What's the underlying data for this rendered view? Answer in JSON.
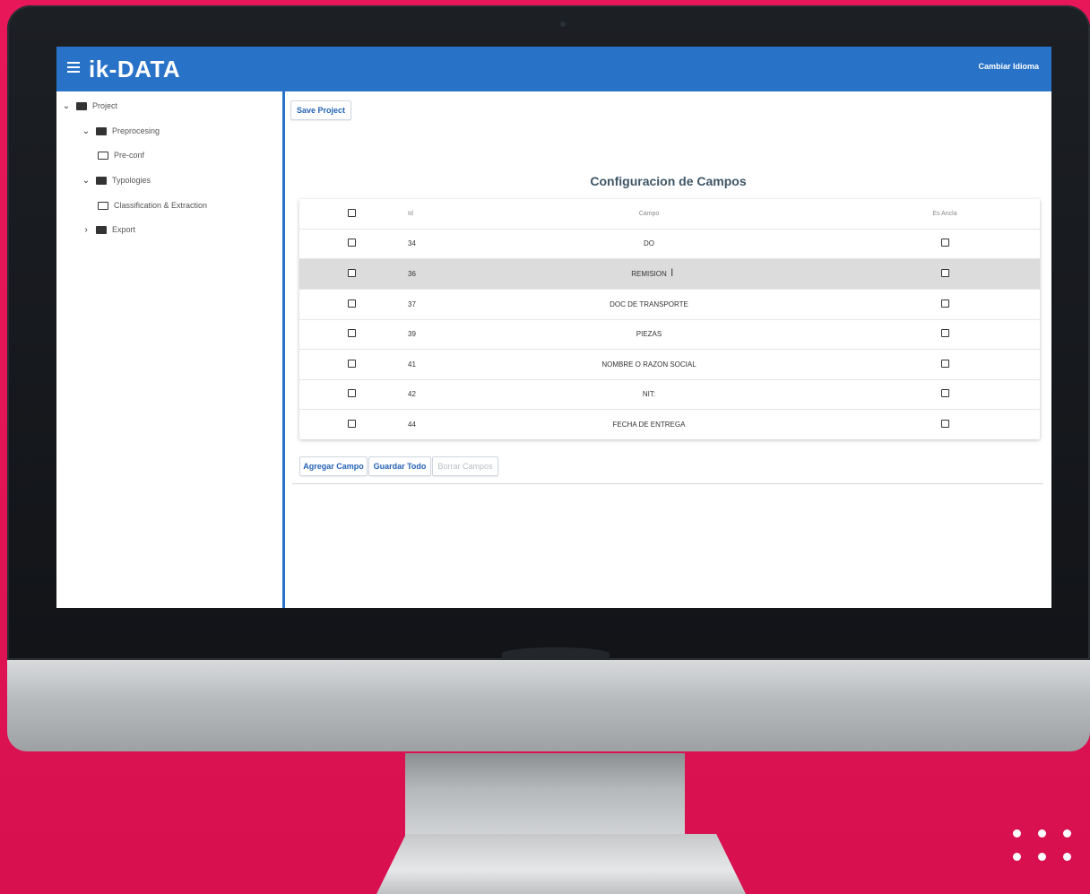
{
  "app": {
    "logo": "ik-DATA",
    "language_button": "Cambiar Idioma"
  },
  "sidebar": {
    "items": [
      {
        "label": "Project",
        "level": 0,
        "chevron": "down",
        "icon": "folder-filled-icon"
      },
      {
        "label": "Preprocesing",
        "level": 1,
        "chevron": "down",
        "icon": "folder-filled-icon"
      },
      {
        "label": "Pre-conf",
        "level": 2,
        "chevron": "",
        "icon": "folder-outline-icon"
      },
      {
        "label": "Typologies",
        "level": 1,
        "chevron": "down",
        "icon": "folder-filled-icon"
      },
      {
        "label": "Classification & Extraction",
        "level": 2,
        "chevron": "",
        "icon": "folder-outline-icon"
      },
      {
        "label": "Export",
        "level": 1,
        "chevron": "right",
        "icon": "folder-filled-icon"
      }
    ]
  },
  "main": {
    "save_button": "Save Project",
    "title": "Configuracion de Campos",
    "table": {
      "headers": {
        "id": "Id",
        "campo": "Campo",
        "es_ancla": "Es Ancla"
      },
      "rows": [
        {
          "id": "34",
          "campo": "DO"
        },
        {
          "id": "36",
          "campo": "REMISION"
        },
        {
          "id": "37",
          "campo": "DOC DE TRANSPORTE"
        },
        {
          "id": "39",
          "campo": "PIEZAS"
        },
        {
          "id": "41",
          "campo": "NOMBRE O RAZON SOCIAL"
        },
        {
          "id": "42",
          "campo": "NIT:"
        },
        {
          "id": "44",
          "campo": "FECHA DE ENTREGA"
        }
      ],
      "highlighted_row": 1
    },
    "actions": {
      "add": "Agregar Campo",
      "save_all": "Guardar Todo",
      "delete": "Borrar Campos"
    }
  },
  "colors": {
    "appbar": "#2872c8",
    "background": "#e8175a",
    "button_text": "#2563b5"
  }
}
